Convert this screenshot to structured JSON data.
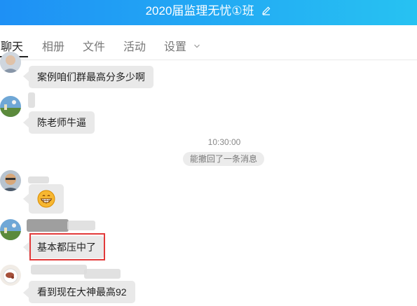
{
  "header": {
    "title": "2020届监理无忧①班",
    "edit_icon": "pencil-icon"
  },
  "tabs": [
    {
      "label": "聊天",
      "active": true
    },
    {
      "label": "相册",
      "active": false
    },
    {
      "label": "文件",
      "active": false
    },
    {
      "label": "活动",
      "active": false
    },
    {
      "label": "设置",
      "active": false,
      "icon": "chevron-down-icon"
    }
  ],
  "messages": [
    {
      "text": "案例咱们群最高分多少啊"
    },
    {
      "text": "陈老师牛逼"
    },
    {
      "emoji": "grinning-face-emoji"
    },
    {
      "text": "基本都压中了"
    },
    {
      "text": "看到现在大神最高92"
    }
  ],
  "timestamp": "10:30:00",
  "system_notice": "能撤回了一条消息",
  "colors": {
    "header_start": "#1e90f5",
    "header_end": "#27c2f2",
    "bubble": "#e9e9e9",
    "highlight": "#e23a3a"
  }
}
